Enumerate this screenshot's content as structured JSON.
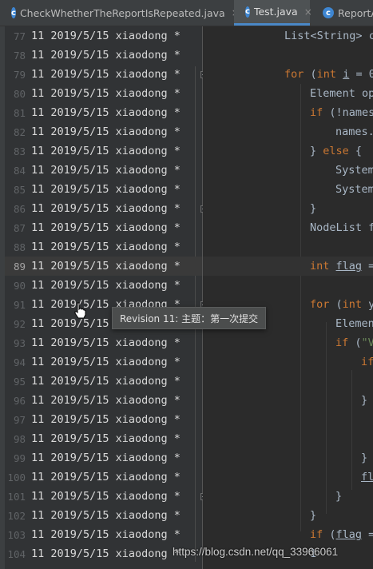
{
  "tabs": [
    {
      "label": "CheckWhetherTheReportIsRepeated.java",
      "icon": "java-class-icon",
      "active": false
    },
    {
      "label": "Test.java",
      "icon": "java-class-icon",
      "active": true
    },
    {
      "label": "ReportA",
      "icon": "java-class-icon",
      "active": false
    }
  ],
  "annotation": {
    "revision": "11",
    "date": "2019/5/15",
    "author": "xiaodong",
    "marker": "*"
  },
  "gutter_lines": [
    {
      "line": "77"
    },
    {
      "line": "78"
    },
    {
      "line": "79"
    },
    {
      "line": "80"
    },
    {
      "line": "81"
    },
    {
      "line": "82"
    },
    {
      "line": "83"
    },
    {
      "line": "84"
    },
    {
      "line": "85"
    },
    {
      "line": "86"
    },
    {
      "line": "87"
    },
    {
      "line": "88"
    },
    {
      "line": "89"
    },
    {
      "line": "90"
    },
    {
      "line": "91"
    },
    {
      "line": "92"
    },
    {
      "line": "93"
    },
    {
      "line": "94"
    },
    {
      "line": "95"
    },
    {
      "line": "96"
    },
    {
      "line": "97"
    },
    {
      "line": "98"
    },
    {
      "line": "99"
    },
    {
      "line": "100"
    },
    {
      "line": "101"
    },
    {
      "line": "102"
    },
    {
      "line": "103"
    },
    {
      "line": "104"
    }
  ],
  "current_line": "89",
  "code_lines": [
    [
      {
        "t": "List<String> c",
        "k": "p"
      }
    ],
    [],
    [
      {
        "t": "for",
        "k": "kw"
      },
      {
        "t": " (",
        "k": "p"
      },
      {
        "t": "int",
        "k": "kw"
      },
      {
        "t": " ",
        "k": "p"
      },
      {
        "t": "i",
        "k": "u"
      },
      {
        "t": " = 0",
        "k": "p"
      }
    ],
    [
      {
        "t": "Element op",
        "k": "p"
      }
    ],
    [
      {
        "t": "if",
        "k": "kw"
      },
      {
        "t": " (!names",
        "k": "p"
      }
    ],
    [
      {
        "t": "names.",
        "k": "p"
      }
    ],
    [
      {
        "t": "} ",
        "k": "p"
      },
      {
        "t": "else",
        "k": "kw"
      },
      {
        "t": " {",
        "k": "p"
      }
    ],
    [
      {
        "t": "System",
        "k": "p"
      }
    ],
    [
      {
        "t": "System",
        "k": "p"
      }
    ],
    [
      {
        "t": "}",
        "k": "p"
      }
    ],
    [
      {
        "t": "NodeList f",
        "k": "p"
      }
    ],
    [],
    [
      {
        "t": "int",
        "k": "kw"
      },
      {
        "t": " ",
        "k": "p"
      },
      {
        "t": "flag",
        "k": "u"
      },
      {
        "t": " =",
        "k": "p"
      }
    ],
    [],
    [
      {
        "t": "for",
        "k": "kw"
      },
      {
        "t": " (",
        "k": "p"
      },
      {
        "t": "int",
        "k": "kw"
      },
      {
        "t": " y",
        "k": "p"
      }
    ],
    [
      {
        "t": "Elemen",
        "k": "p"
      }
    ],
    [
      {
        "t": "if",
        "k": "kw"
      },
      {
        "t": " (",
        "k": "p"
      },
      {
        "t": "\"V",
        "k": "str"
      }
    ],
    [
      {
        "t": "if",
        "k": "kw"
      }
    ],
    [],
    [
      {
        "t": "}",
        "k": "p"
      }
    ],
    [],
    [],
    [
      {
        "t": "}",
        "k": "p"
      }
    ],
    [
      {
        "t": "fl",
        "k": "u"
      }
    ],
    [
      {
        "t": "}",
        "k": "p"
      }
    ],
    [
      {
        "t": "}",
        "k": "p"
      }
    ],
    [
      {
        "t": "if",
        "k": "kw"
      },
      {
        "t": " (",
        "k": "p"
      },
      {
        "t": "flag",
        "k": "u"
      },
      {
        "t": " =",
        "k": "p"
      }
    ],
    [
      {
        "t": "1",
        "k": "p"
      }
    ]
  ],
  "tooltip": {
    "text": "Revision 11: 主题：第一次提交"
  },
  "watermark": {
    "text": "https://blog.csdn.net/qq_33966061"
  },
  "colors": {
    "keyword": "#cc7832",
    "identifier": "#a9b7c6",
    "string": "#6a8759",
    "accent": "#4a88c7"
  }
}
